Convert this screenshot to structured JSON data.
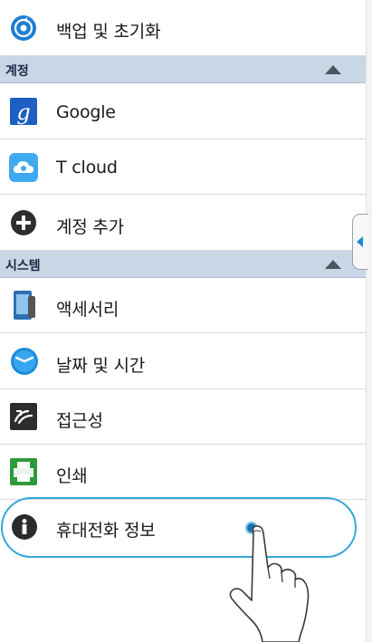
{
  "rows_top": {
    "backup": {
      "label": "백업 및 초기화",
      "icon": "backup-reset-icon"
    }
  },
  "sections": {
    "account": {
      "title": "계정",
      "toggle_icon": "collapse-triangle-icon"
    },
    "system": {
      "title": "시스템",
      "toggle_icon": "collapse-triangle-icon"
    }
  },
  "account_items": [
    {
      "label": "Google",
      "icon": "google-icon"
    },
    {
      "label": "T cloud",
      "icon": "t-cloud-icon"
    },
    {
      "label": "계정 추가",
      "icon": "add-account-icon"
    }
  ],
  "system_items": [
    {
      "label": "액세서리",
      "icon": "accessory-icon"
    },
    {
      "label": "날짜 및 시간",
      "icon": "clock-icon"
    },
    {
      "label": "접근성",
      "icon": "accessibility-icon"
    },
    {
      "label": "인쇄",
      "icon": "printer-icon"
    },
    {
      "label": "휴대전화 정보",
      "icon": "info-icon"
    }
  ],
  "colors": {
    "section_header": "#c9d6e6",
    "highlight": "#38a8d6",
    "google_blue": "#1d5fc2"
  }
}
